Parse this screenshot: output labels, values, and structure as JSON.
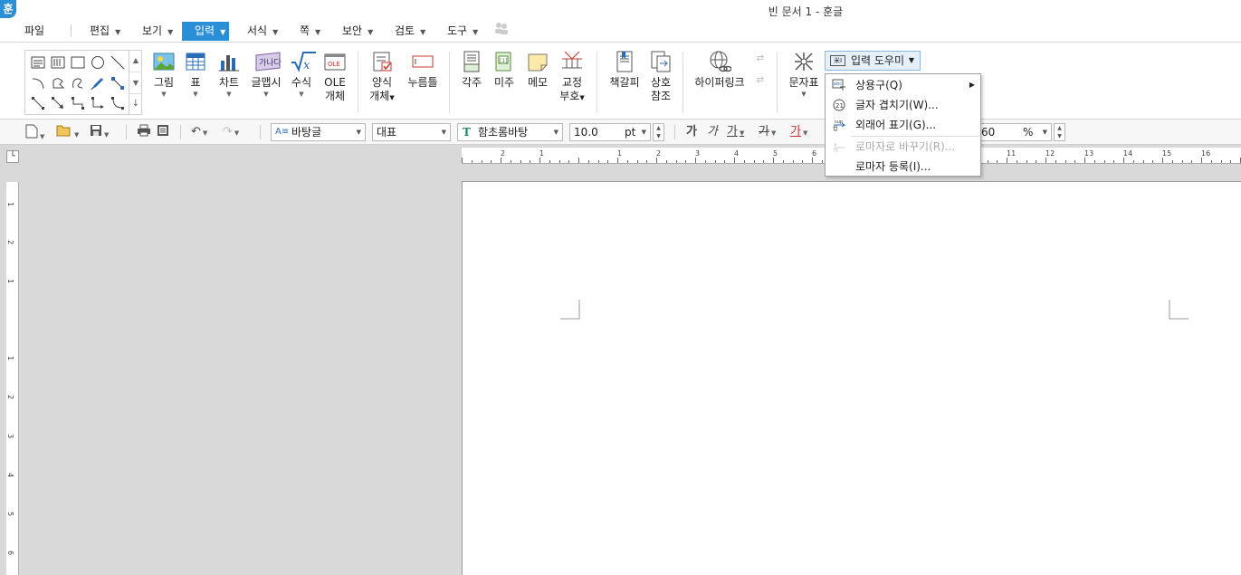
{
  "title_bar": {
    "logo": "훈",
    "title": "빈 문서 1 - 훈글"
  },
  "menu": {
    "file": "파일",
    "items": [
      "편집",
      "보기",
      "입력",
      "서식",
      "쪽",
      "보안",
      "검토",
      "도구"
    ],
    "active": "입력"
  },
  "ribbon": {
    "picture": "그림",
    "table": "표",
    "chart": "차트",
    "textart": "글맵시",
    "equation": "수식",
    "ole_1": "OLE",
    "ole_2": "개체",
    "form_1": "양식",
    "form_2": "개체",
    "button": "누름틀",
    "footnote": "각주",
    "endnote": "미주",
    "memo": "메모",
    "proof_1": "교정",
    "proof_2": "부호",
    "bookmark": "책갈피",
    "cross_1": "상호",
    "cross_2": "참조",
    "hyperlink": "하이퍼링크",
    "char_map": "문자표",
    "input_helper": "입력 도우미",
    "table_icon_text": "가나다",
    "ole_icon_text": "OLE"
  },
  "toolbar": {
    "style": "바탕글",
    "type": "대표",
    "font": "함초롬바탕",
    "size": "10.0",
    "size_unit": "pt",
    "zoom": "60",
    "zoom_unit": "%",
    "bold_sample": "가",
    "italic_sample": "가",
    "underline_sample": "가",
    "strike_sample": "가",
    "color_sample": "가"
  },
  "dropdown": {
    "items": [
      {
        "label": "상용구(Q)",
        "icon": "phrase-icon",
        "disabled": false,
        "submenu": true
      },
      {
        "label": "글자 겹치기(W)...",
        "icon": "overlap-icon",
        "disabled": false,
        "submenu": false
      },
      {
        "label": "외래어 표기(G)...",
        "icon": "foreign-word-icon",
        "disabled": false,
        "submenu": false
      },
      {
        "label": "로마자로 바꾸기(R)...",
        "icon": "romanize-icon",
        "disabled": true,
        "submenu": false
      },
      {
        "label": "로마자 등록(I)...",
        "icon": "",
        "disabled": false,
        "submenu": false
      }
    ]
  },
  "ruler": {
    "labels": [
      "2",
      "1",
      "1",
      "2",
      "3",
      "4",
      "5",
      "6",
      "11",
      "12",
      "13",
      "14",
      "15",
      "16"
    ],
    "vertical": [
      "1",
      "2",
      "1",
      "1",
      "2",
      "3",
      "4",
      "5",
      "6"
    ]
  },
  "colors": {
    "accent": "#2a8fd6",
    "page": "#ffffff",
    "workspace": "#d9d9d9"
  }
}
